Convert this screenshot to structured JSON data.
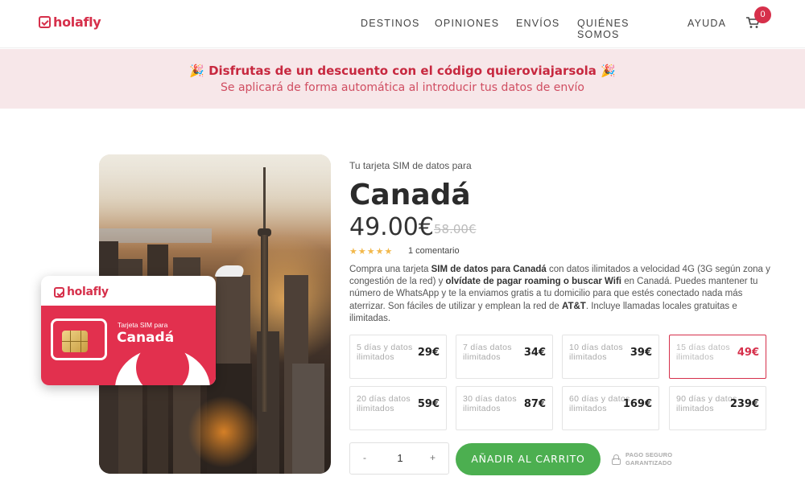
{
  "brand": {
    "name": "holafly",
    "color": "#d6304b"
  },
  "nav": {
    "items": [
      "DESTINOS",
      "OPINIONES",
      "ENVÍOS",
      "QUIÉNES SOMOS",
      "AYUDA"
    ],
    "cart_count": "0"
  },
  "promo": {
    "line1": "Disfrutas de un descuento con el código quieroviajarsola",
    "line2": "Se aplicará de forma automática al introducir tus datos de envío",
    "icon": "party-popper-icon"
  },
  "sim_card": {
    "brand": "holafly",
    "small_label": "Tarjeta SIM para",
    "big_label": "Canadá"
  },
  "product": {
    "subtitle": "Tu tarjeta SIM de datos para",
    "title": "Canadá",
    "price": "49.00€",
    "old_price": "58.00€",
    "rating_stars": 5,
    "reviews": "1 comentario",
    "description": {
      "p1": "Compra una tarjeta ",
      "b1": "SIM de datos para Canadá",
      "p2": " con datos ilimitados a velocidad 4G (3G según zona y congestión de la red) y ",
      "b2": "olvídate de pagar roaming o buscar Wifi",
      "p3": " en Canadá. Puedes mantener tu número de WhatsApp y te la enviamos gratis a tu domicilio para que estés conectado nada más aterrizar. Son fáciles de utilizar y emplean la red de ",
      "b3": "AT&T",
      "p4": ". Incluye llamadas locales gratuitas e ilimitadas."
    }
  },
  "plans": [
    {
      "label": "5 días y datos ilimitados",
      "price": "29€",
      "selected": false
    },
    {
      "label": "7 días datos ilimitados",
      "price": "34€",
      "selected": false
    },
    {
      "label": "10 días datos ilimitados",
      "price": "39€",
      "selected": false
    },
    {
      "label": "15 días datos ilimitados",
      "price": "49€",
      "selected": true
    },
    {
      "label": "20 días datos ilimitados",
      "price": "59€",
      "selected": false
    },
    {
      "label": "30 días datos ilimitados",
      "price": "87€",
      "selected": false
    },
    {
      "label": "60 días y datos ilimitados",
      "price": "169€",
      "selected": false
    },
    {
      "label": "90 días y datos ilimitados",
      "price": "239€",
      "selected": false
    }
  ],
  "quantity": {
    "minus": "-",
    "value": "1",
    "plus": "+"
  },
  "cta": {
    "add_to_cart": "AÑADIR AL CARRITO",
    "color": "#4caf50"
  },
  "secure": {
    "line1": "PAGO SEGURO",
    "line2": "GARANTIZADO"
  }
}
